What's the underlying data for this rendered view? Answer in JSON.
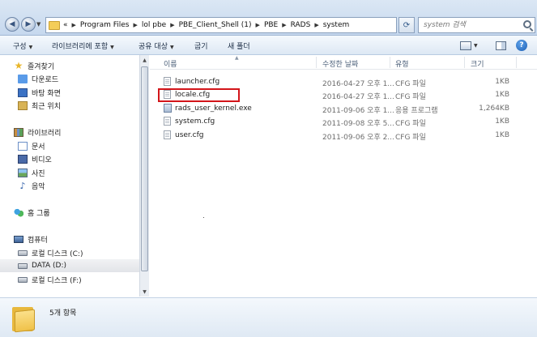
{
  "address": {
    "overflow": "«",
    "crumbs": [
      "Program Files",
      "lol pbe",
      "PBE_Client_Shell (1)",
      "PBE",
      "RADS",
      "system"
    ],
    "search_placeholder": "system 검색"
  },
  "toolbar": {
    "organize": "구성",
    "include_library": "라이브러리에 포함",
    "share": "공유 대상",
    "burn": "굽기",
    "new_folder": "새 폴더"
  },
  "nav": {
    "favorites": "즐겨찾기",
    "downloads": "다운로드",
    "desktop": "바탕 화면",
    "recent": "최근 위치",
    "libraries": "라이브러리",
    "documents": "문서",
    "videos": "비디오",
    "pictures": "사진",
    "music": "음악",
    "homegroup": "홈 그룹",
    "computer": "컴퓨터",
    "drive_c": "로컬 디스크 (C:)",
    "drive_d": "DATA (D:)",
    "drive_f": "로컬 디스크 (F:)"
  },
  "columns": {
    "name": "이름",
    "modified": "수정한 날짜",
    "type": "유형",
    "size": "크기"
  },
  "files": [
    {
      "name": "launcher.cfg",
      "modified": "2016-04-27 오후 1...",
      "type": "CFG 파일",
      "size": "1KB"
    },
    {
      "name": "locale.cfg",
      "modified": "2016-04-27 오후 1...",
      "type": "CFG 파일",
      "size": "1KB"
    },
    {
      "name": "rads_user_kernel.exe",
      "modified": "2011-09-06 오후 1...",
      "type": "응용 프로그램",
      "size": "1,264KB"
    },
    {
      "name": "system.cfg",
      "modified": "2011-09-08 오후 5...",
      "type": "CFG 파일",
      "size": "1KB"
    },
    {
      "name": "user.cfg",
      "modified": "2011-09-06 오후 2...",
      "type": "CFG 파일",
      "size": "1KB"
    }
  ],
  "details": {
    "count": "5개 항목"
  }
}
